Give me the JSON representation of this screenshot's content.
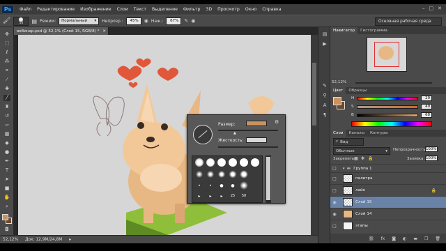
{
  "app": {
    "logo": "Ps",
    "menu": [
      "Файл",
      "Редактирование",
      "Изображение",
      "Слои",
      "Текст",
      "Выделение",
      "Фильтр",
      "3D",
      "Просмотр",
      "Окно",
      "Справка"
    ],
    "window_controls": [
      "–",
      "□",
      "✕"
    ]
  },
  "options": {
    "brush_size": "54",
    "mode_label": "Режим:",
    "mode_value": "Нормальный",
    "opacity_label": "Непрозр.:",
    "opacity_value": "45%",
    "pressure_label": "Наж.:",
    "pressure_value": "67%",
    "workspace": "Основная рабочая среда"
  },
  "document": {
    "tab_title": "вебинар.psd @ 52,1% (Слой 15, RGB/8) *",
    "zoom": "52,12%",
    "doc_info": "Док: 12,9M/24,8M"
  },
  "brush_picker": {
    "size_label": "Размер:",
    "hardness_label": "Жесткость:",
    "preset_numbers": [
      "25",
      "50"
    ]
  },
  "navigator": {
    "tabs": [
      "Навигатор",
      "Гистограмма"
    ],
    "zoom": "52,12%"
  },
  "color": {
    "tabs": [
      "Цвет",
      "Образцы"
    ],
    "channels": [
      {
        "label": "H",
        "value": "29",
        "pos": 0.08
      },
      {
        "label": "S",
        "value": "49",
        "pos": 0.49
      },
      {
        "label": "B",
        "value": "68",
        "pos": 0.68
      }
    ],
    "foreground": "#c9925f",
    "background": "#6b4a30"
  },
  "layers": {
    "tabs": [
      "Слои",
      "Каналы",
      "Контуры"
    ],
    "kind_filter": "Вид",
    "blend_mode": "Обычные",
    "opacity_label": "Непрозрачность:",
    "opacity_value": "100%",
    "lock_label": "Закрепить:",
    "fill_label": "Заливка:",
    "fill_value": "100%",
    "items": [
      {
        "name": "Группа 1",
        "type": "group",
        "visible": false
      },
      {
        "name": "палитра",
        "type": "layer",
        "visible": false
      },
      {
        "name": "лайн",
        "type": "layer",
        "visible": false
      },
      {
        "name": "Слой 15",
        "type": "layer",
        "visible": true,
        "selected": true
      },
      {
        "name": "Слой 14",
        "type": "layer",
        "visible": true
      },
      {
        "name": "этапы",
        "type": "layer",
        "visible": false
      }
    ]
  }
}
